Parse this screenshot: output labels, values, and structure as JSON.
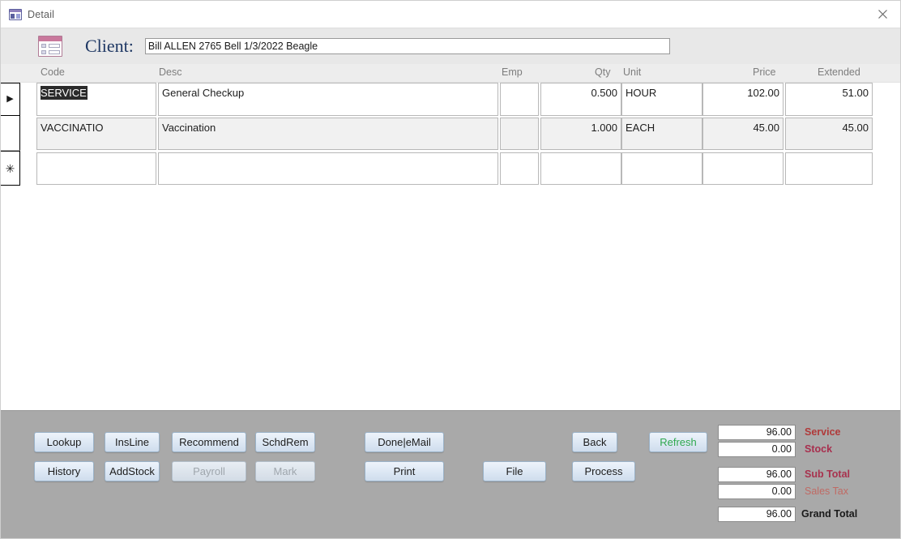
{
  "window": {
    "title": "Detail",
    "title_icon": "form-table-icon",
    "close_icon": "close-icon"
  },
  "header": {
    "form_icon": "form-table-icon",
    "client_label": "Client:",
    "client_value": "Bill ALLEN 2765 Bell 1/3/2022 Beagle",
    "client_placeholder": ""
  },
  "grid": {
    "columns": [
      {
        "key": "code",
        "label": "Code",
        "align": "left"
      },
      {
        "key": "desc",
        "label": "Desc",
        "align": "left"
      },
      {
        "key": "emp",
        "label": "Emp",
        "align": "left"
      },
      {
        "key": "qty",
        "label": "Qty",
        "align": "right"
      },
      {
        "key": "unit",
        "label": "Unit",
        "align": "left"
      },
      {
        "key": "price",
        "label": "Price",
        "align": "right"
      },
      {
        "key": "extended",
        "label": "Extended",
        "align": "right"
      }
    ],
    "record_selector": {
      "current_glyph": "▶",
      "new_record_glyph": "✳"
    },
    "rows": [
      {
        "selected": true,
        "code": "SERVICE",
        "code_selected_text": true,
        "desc": "General Checkup",
        "emp": "",
        "qty": "0.500",
        "unit": "HOUR",
        "price": "102.00",
        "extended": "51.00"
      },
      {
        "selected": false,
        "code": "VACCINATIO",
        "code_selected_text": false,
        "desc": "Vaccination",
        "emp": "",
        "qty": "1.000",
        "unit": "EACH",
        "price": "45.00",
        "extended": "45.00"
      },
      {
        "selected": false,
        "new_record": true,
        "code": "",
        "code_selected_text": false,
        "desc": "",
        "emp": "",
        "qty": "",
        "unit": "",
        "price": "",
        "extended": ""
      }
    ]
  },
  "buttons": {
    "lookup": "Lookup",
    "insline": "InsLine",
    "recommend": "Recommend",
    "schdrem": "SchdRem",
    "history": "History",
    "addstock": "AddStock",
    "payroll": "Payroll",
    "mark": "Mark",
    "done_email": "Done|eMail",
    "print": "Print",
    "file": "File",
    "back": "Back",
    "process": "Process",
    "refresh": "Refresh"
  },
  "totals": {
    "service_value": "96.00",
    "service_label": "Service",
    "stock_value": "0.00",
    "stock_label": "Stock",
    "subtotal_value": "96.00",
    "subtotal_label": "Sub Total",
    "salestax_value": "0.00",
    "salestax_label": "Sales Tax",
    "grandtotal_value": "96.00",
    "grandtotal_label": "Grand Total"
  },
  "colors": {
    "panel_grey": "#a9a9a9",
    "band_grey": "#e8e8e8",
    "client_label_navy": "#1f3864",
    "refresh_green": "#2fa84f",
    "service_red": "#b03a3a",
    "subtotal_red": "#a8324e",
    "salestax_red": "#c06a64",
    "button_blue_border": "#9bb3c9"
  }
}
